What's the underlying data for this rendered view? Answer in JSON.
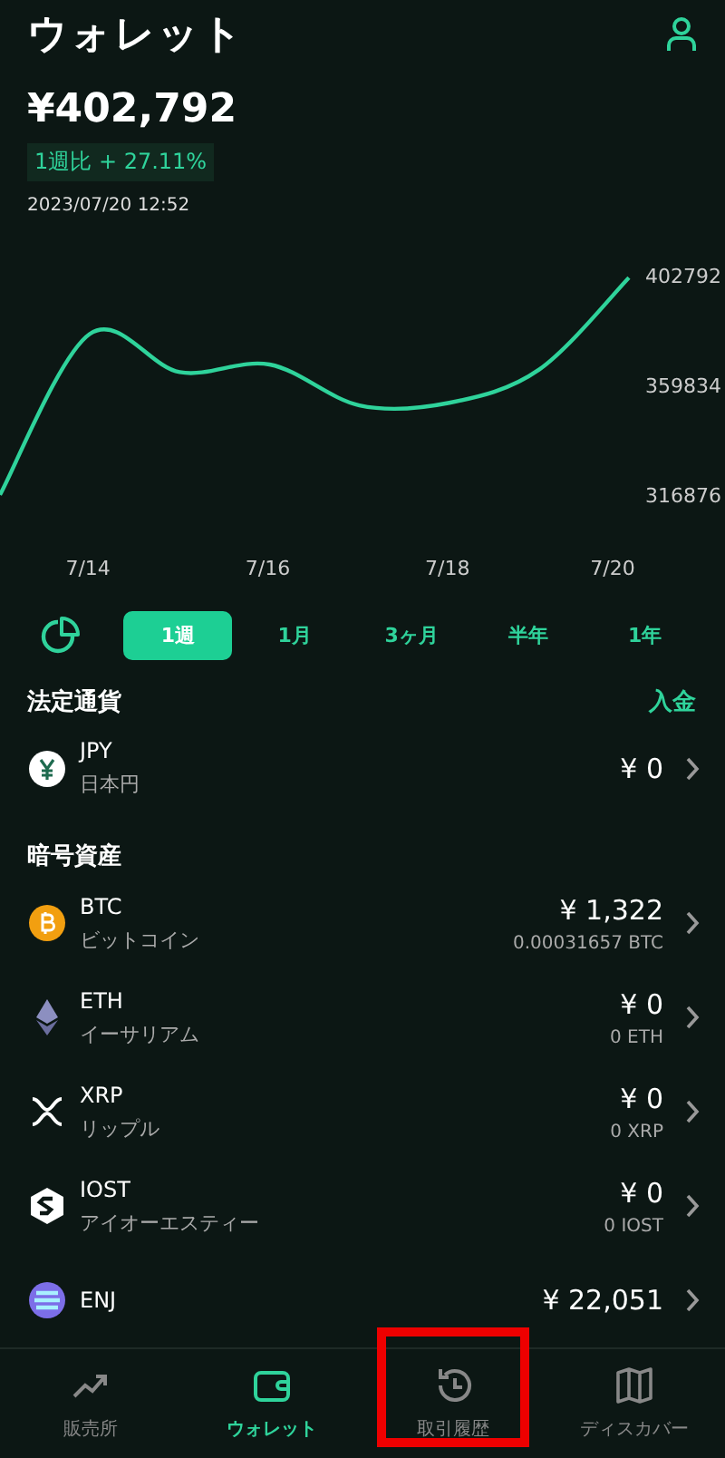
{
  "header": {
    "title": "ウォレット"
  },
  "balance": {
    "amount": "¥402,792",
    "change": "1週比 + 27.11%",
    "timestamp": "2023/07/20 12:52"
  },
  "chart": {
    "chart_data": {
      "type": "line",
      "categories": [
        null,
        "7/14",
        null,
        "7/16",
        null,
        "7/18",
        null,
        "7/20"
      ],
      "series": [
        {
          "color": "#2fd39b",
          "values": [
            317000,
            380000,
            365000,
            368000,
            352000,
            353000,
            366000,
            402000
          ]
        }
      ],
      "ylim": [
        316876,
        402792
      ],
      "yticks": [
        316876,
        359834,
        402792
      ]
    }
  },
  "periods": [
    {
      "label": "1週",
      "selected": true
    },
    {
      "label": "1月",
      "selected": false
    },
    {
      "label": "3ヶ月",
      "selected": false
    },
    {
      "label": "半年",
      "selected": false
    },
    {
      "label": "1年",
      "selected": false
    }
  ],
  "fiat": {
    "heading": "法定通貨",
    "action": "入金",
    "items": [
      {
        "kind": "yen",
        "symbol": "JPY",
        "name": "日本円",
        "value": "¥ 0"
      }
    ]
  },
  "crypto": {
    "heading": "暗号資産",
    "items": [
      {
        "kind": "btc",
        "symbol": "BTC",
        "name": "ビットコイン",
        "value": "¥ 1,322",
        "quantity": "0.00031657 BTC"
      },
      {
        "kind": "eth",
        "symbol": "ETH",
        "name": "イーサリアム",
        "value": "¥ 0",
        "quantity": "0 ETH"
      },
      {
        "kind": "xrp",
        "symbol": "XRP",
        "name": "リップル",
        "value": "¥ 0",
        "quantity": "0 XRP"
      },
      {
        "kind": "iost",
        "symbol": "IOST",
        "name": "アイオーエスティー",
        "value": "¥ 0",
        "quantity": "0 IOST"
      },
      {
        "kind": "enj",
        "symbol": "ENJ",
        "value": "¥ 22,051"
      }
    ]
  },
  "bottom_nav": [
    {
      "kind": "trend",
      "label": "販売所",
      "selected": false,
      "highlighted": false
    },
    {
      "kind": "wallet",
      "label": "ウォレット",
      "selected": true,
      "highlighted": false
    },
    {
      "kind": "history",
      "label": "取引履歴",
      "selected": false,
      "highlighted": true
    },
    {
      "kind": "map",
      "label": "ディスカバー",
      "selected": false,
      "highlighted": false
    }
  ]
}
